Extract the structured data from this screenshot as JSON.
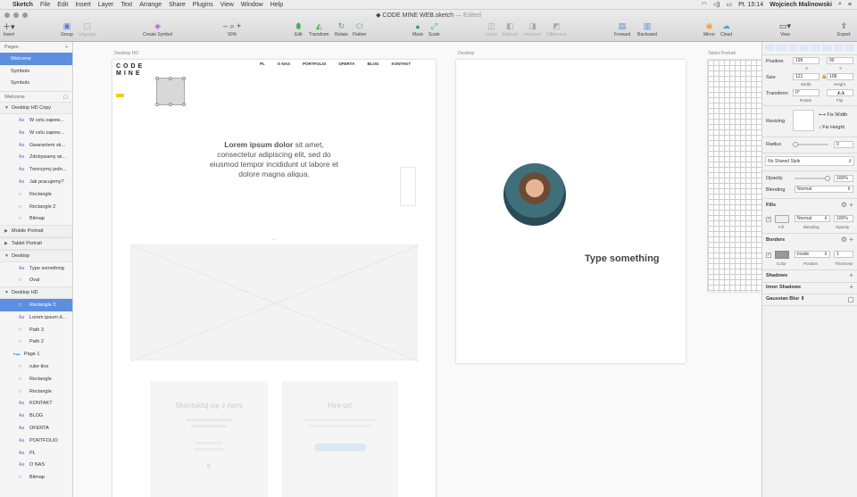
{
  "menubar": {
    "app": "Sketch",
    "items": [
      "File",
      "Edit",
      "Insert",
      "Layer",
      "Text",
      "Arrange",
      "Share",
      "Plugins",
      "View",
      "Window",
      "Help"
    ],
    "clock": "Pt. 15:14",
    "user": "Wojciech Malinowski"
  },
  "window": {
    "title": "CODE MINE WEB.sketch",
    "edited": "— Edited"
  },
  "toolbar": {
    "insert": "Insert",
    "group": "Group",
    "ungroup": "Ungroup",
    "create_symbol": "Create Symbol",
    "zoom": "50%",
    "edit": "Edit",
    "transform": "Transform",
    "rotate": "Rotate",
    "flatten": "Flatten",
    "mask": "Mask",
    "scale": "Scale",
    "union": "Union",
    "subtract": "Subtract",
    "intersect": "Intersect",
    "difference": "Difference",
    "forward": "Forward",
    "backward": "Backward",
    "mirror": "Mirror",
    "cloud": "Cloud",
    "view": "View",
    "export": "Export"
  },
  "pages": {
    "header": "Pages",
    "items": [
      "Welcome",
      "Symbols",
      "Symbols"
    ],
    "current": "Welcome"
  },
  "layers": [
    {
      "t": "group",
      "label": "Desktop HD Copy"
    },
    {
      "t": "text",
      "label": "W celu zapew..."
    },
    {
      "t": "text",
      "label": "W celu zapew..."
    },
    {
      "t": "text",
      "label": "Gwarantem sk..."
    },
    {
      "t": "text",
      "label": "Zdobywamy wi..."
    },
    {
      "t": "text",
      "label": "Tworzymy jedn..."
    },
    {
      "t": "text",
      "label": "Jak pracujemy?"
    },
    {
      "t": "shape",
      "label": "Rectangle"
    },
    {
      "t": "shape",
      "label": "Rectangle 2"
    },
    {
      "t": "shape",
      "label": "Bitmap"
    },
    {
      "t": "groupc",
      "label": "Mobile Portrait"
    },
    {
      "t": "groupc",
      "label": "Tablet Portrait"
    },
    {
      "t": "group",
      "label": "Desktop"
    },
    {
      "t": "text",
      "label": "Type something"
    },
    {
      "t": "shape",
      "label": "Oval"
    },
    {
      "t": "group",
      "label": "Desktop HD"
    },
    {
      "t": "shapesel",
      "label": "Rectangle 3"
    },
    {
      "t": "text",
      "label": "Lorem ipsum d..."
    },
    {
      "t": "shape",
      "label": "Path 3"
    },
    {
      "t": "shape",
      "label": "Path 2"
    },
    {
      "t": "folder",
      "label": "Page 1"
    },
    {
      "t": "shape",
      "label": "ruler-line"
    },
    {
      "t": "shape",
      "label": "Rectangle"
    },
    {
      "t": "shape",
      "label": "Rectangle"
    },
    {
      "t": "text",
      "label": "KONTAKT"
    },
    {
      "t": "text",
      "label": "BLOG"
    },
    {
      "t": "text",
      "label": "OFERTA"
    },
    {
      "t": "text",
      "label": "PORTFOLIO"
    },
    {
      "t": "text",
      "label": "PL"
    },
    {
      "t": "text",
      "label": "O NAS"
    },
    {
      "t": "shape",
      "label": "Bitmap"
    }
  ],
  "artboards": {
    "desktop_hd": "Desktop HD",
    "desktop": "Desktop",
    "tablet": "Tablet Portrait"
  },
  "hd": {
    "nav": [
      "PL",
      "O NAS",
      "PORTFOLIO",
      "OFERTA",
      "BLOG",
      "KONTAKT"
    ],
    "lorem_bold": "Lorem ipsum dolor",
    "lorem_rest": " sit amet, consectetur adipiscing elit, sed do eiusmod tempor incididunt ut labore et dolore magna aliqua.",
    "contact_title": "Skontaktuj się z nami",
    "hire_title": "Hire us!",
    "logo": "CODE MINE"
  },
  "desktop": {
    "type_something": "Type something"
  },
  "inspector": {
    "position": "Position",
    "x": "199",
    "y": "90",
    "x_lbl": "X",
    "y_lbl": "Y",
    "size": "Size",
    "w": "121",
    "h": "108",
    "w_lbl": "Width",
    "h_lbl": "Height",
    "transform": "Transform",
    "rot": "0°",
    "rot_lbl": "Rotate",
    "flip_lbl": "Flip",
    "resizing": "Resizing",
    "fix_width": "Fix Width",
    "fix_height": "Fix Height",
    "radius": "Radius",
    "radius_val": "0",
    "shared_style": "No Shared Style",
    "opacity": "Opacity",
    "opacity_val": "100%",
    "blending": "Blending",
    "blending_val": "Normal",
    "fills": "Fills",
    "fill_blend": "Normal",
    "fill_op": "100%",
    "fill_lbl": "Fill",
    "blend_lbl": "Blending",
    "op_lbl": "Opacity",
    "borders": "Borders",
    "border_pos": "Inside",
    "border_w": "1",
    "color_lbl": "Color",
    "pos_lbl": "Position",
    "thick_lbl": "Thickness",
    "shadows": "Shadows",
    "inner_shadows": "Inner Shadows",
    "blur": "Gaussian Blur"
  },
  "colors": {
    "accent": "#5c8fe0",
    "logo_yellow": "#f2d100"
  }
}
